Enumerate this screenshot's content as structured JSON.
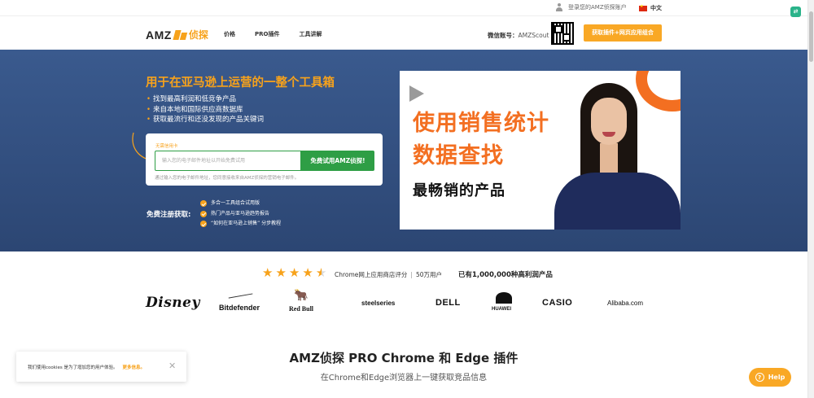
{
  "topbar": {
    "login_label": "登录您的AMZ侦探账户",
    "language": "中文"
  },
  "navbar": {
    "logo_text": "AMZ",
    "logo_cn": "侦探",
    "links": [
      "价格",
      "PRO插件",
      "工具讲解"
    ],
    "wechat_label": "微信账号：",
    "wechat_id": "AMZScout",
    "cta": "获取插件+网页应用组合"
  },
  "hero": {
    "title": "用于在亚马逊上运营的一整个工具箱",
    "bullets": [
      "找到最高利润和低竞争产品",
      "来自本地和国际供应商数据库",
      "获取最流行和还没发现的产品关键词"
    ],
    "card_label": "无需信用卡",
    "email_placeholder": "输入您的电子邮件地址以开始免费试用",
    "try_button": "免费试用AMZ侦探!",
    "card_note": "通过输入您的电子邮件地址，您同意接收来自AMZ侦探的营销电子邮件。",
    "free_label": "免费注册获取:",
    "perks": [
      "多合一工具组合试用版",
      "热门产品与亚马逊趋势报告",
      "“如何在亚马逊上销售” 分步教程"
    ],
    "video": {
      "line1": "使用销售统计",
      "line2": "数据查找",
      "line3": "最畅销的产品"
    }
  },
  "stats": {
    "rating": 4.5,
    "rating_text": "Chrome网上应用商店评分",
    "users": "50万用户",
    "products": "已有1,000,000种高利润产品",
    "brands": [
      "Disney",
      "Bitdefender",
      "Red Bull",
      "steelseries",
      "DELL",
      "HUAWEI",
      "CASIO",
      "Alibaba.com"
    ]
  },
  "section": {
    "title": "AMZ侦探 PRO Chrome 和 Edge 插件",
    "subtitle": "在Chrome和Edge浏览器上一键获取竞品信息"
  },
  "cookie": {
    "text": "我们使用cookies 是为了增加您的用户体验。",
    "more": "更多信息。"
  },
  "help": {
    "label": "Help"
  },
  "colors": {
    "accent": "#f9a825",
    "hero_bg": "#2f4a78",
    "cta_green": "#2e9e45",
    "video_accent": "#f36f21"
  }
}
